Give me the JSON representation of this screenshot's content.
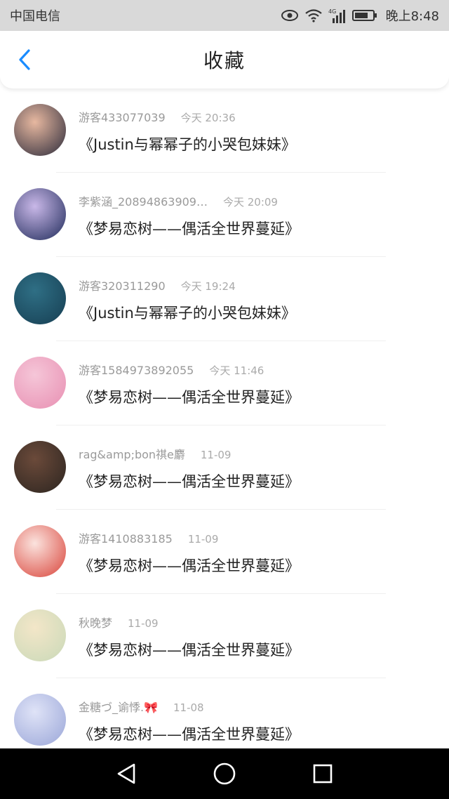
{
  "status_bar": {
    "carrier": "中国电信",
    "network": "4G",
    "time": "晚上8:48"
  },
  "header": {
    "title": "收藏",
    "back_icon": "chevron-left-icon",
    "accent": "#1a8cff"
  },
  "favorites": [
    {
      "user": "游客433077039",
      "time": "今天 20:36",
      "book": "《Justin与幂幂子的小哭包妹妹》",
      "avatar_colors": [
        "#e7b8a0",
        "#2b2a3a"
      ]
    },
    {
      "user": "李紫涵_20894863909…",
      "time": "今天 20:09",
      "book": "《梦易恋树——偶活全世界蔓延》",
      "avatar_colors": [
        "#c9b8e8",
        "#1f2a5a"
      ]
    },
    {
      "user": "游客320311290",
      "time": "今天 19:24",
      "book": "《Justin与幂幂子的小哭包妹妹》",
      "avatar_colors": [
        "#2f6f85",
        "#163e52"
      ]
    },
    {
      "user": "游客15849738920​55",
      "time": "今天 11:46",
      "book": "《梦易恋树——偶活全世界蔓延》",
      "avatar_colors": [
        "#f5c6d8",
        "#e88fb2"
      ]
    },
    {
      "user": "rag&amp;bon祺e麝",
      "time": "11-09",
      "book": "《梦易恋树——偶活全世界蔓延》",
      "avatar_colors": [
        "#6b4a3a",
        "#2c2520"
      ]
    },
    {
      "user": "游客1410883185",
      "time": "11-09",
      "book": "《梦易恋树——偶活全世界蔓延》",
      "avatar_colors": [
        "#fbe3de",
        "#d9443a"
      ]
    },
    {
      "user": "秋晚梦",
      "time": "11-09",
      "book": "《梦易恋树——偶活全世界蔓延》",
      "avatar_colors": [
        "#f3e6c8",
        "#c9d9b8"
      ]
    },
    {
      "user": "金糖づ_谕悸.🎀",
      "time": "11-08",
      "book": "《梦易恋树——偶活全世界蔓延》",
      "avatar_colors": [
        "#dfe3f7",
        "#9aa6d8"
      ]
    }
  ],
  "nav_bar": {
    "back": "triangle-back-icon",
    "home": "circle-home-icon",
    "recents": "square-recents-icon"
  }
}
